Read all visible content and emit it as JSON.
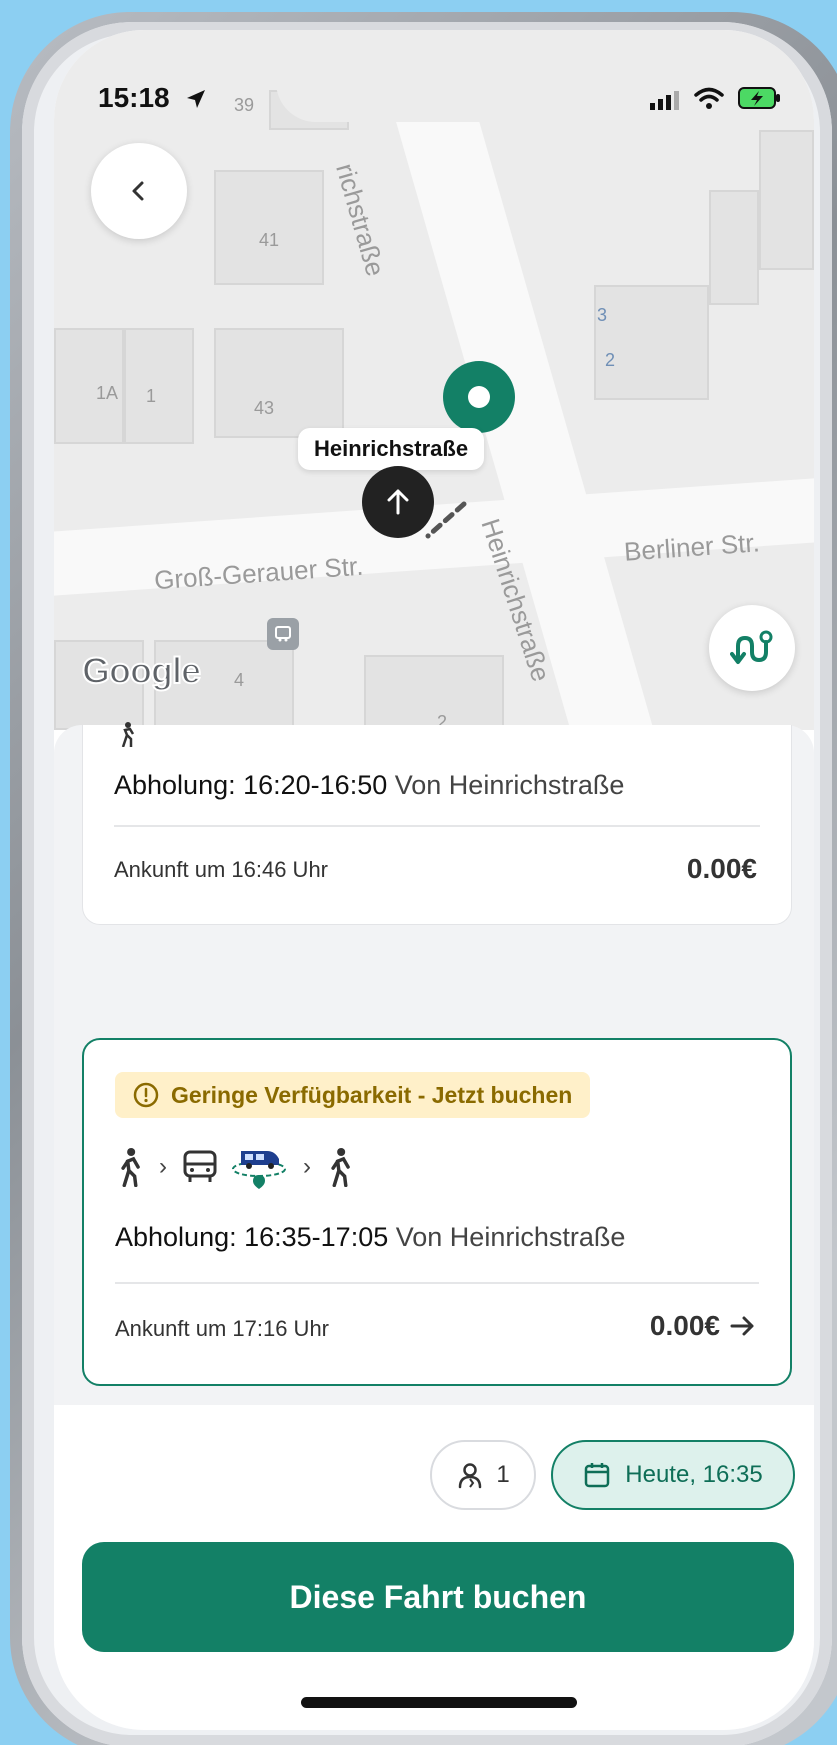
{
  "status_bar": {
    "time": "15:18"
  },
  "map": {
    "label": "Heinrichstraße",
    "streets": {
      "top": "richstraße",
      "cross_left": "Groß-Gerauer Str.",
      "cross_right": "Berliner Str.",
      "bottom": "Heinrichstraße"
    },
    "house_numbers": [
      "39",
      "41",
      "43",
      "1A",
      "1",
      "3",
      "2",
      "4",
      "2"
    ],
    "google_logo": "Google"
  },
  "cards": [
    {
      "pickup_label": "Abholung: 16:20-16:50",
      "pickup_from": "Von Heinrichstraße",
      "arrival": "Ankunft um 16:46 Uhr",
      "price": "0.00€"
    },
    {
      "warning": "Geringe Verfügbarkeit - Jetzt buchen",
      "pickup_label": "Abholung: 16:35-17:05",
      "pickup_from": "Von Heinrichstraße",
      "arrival": "Ankunft um 17:16 Uhr",
      "price": "0.00€"
    }
  ],
  "footer": {
    "passengers": "1",
    "date": "Heute, 16:35",
    "book_button": "Diese Fahrt buchen"
  },
  "colors": {
    "brand": "#138066",
    "warning_bg": "#fff0c9",
    "warning_text": "#8a6a00"
  },
  "icons": [
    "back-icon",
    "route-icon",
    "location-arrow-icon",
    "walk-icon",
    "bus-icon",
    "van-icon",
    "alert-icon",
    "person-icon",
    "calendar-icon",
    "arrow-right-icon"
  ]
}
